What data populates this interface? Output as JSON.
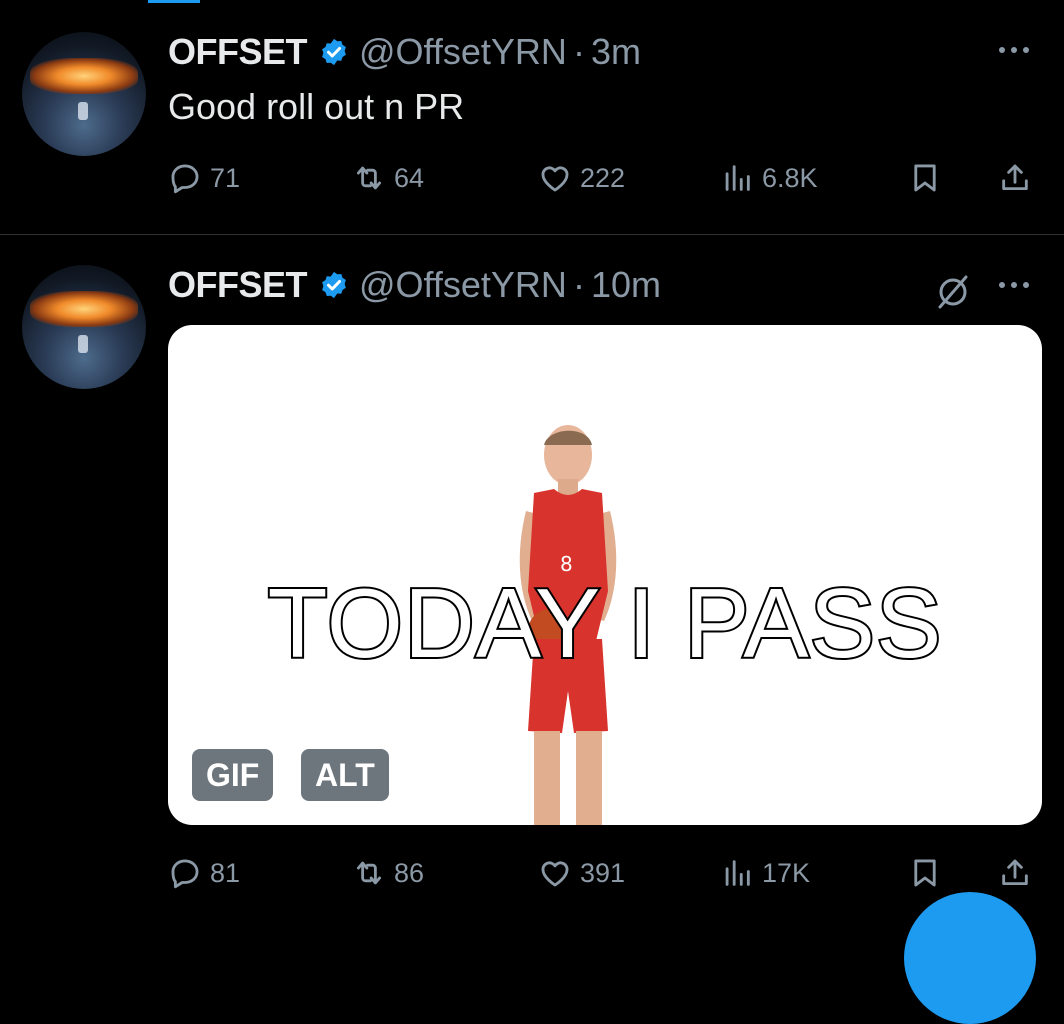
{
  "tweets": [
    {
      "name": "OFFSET",
      "handle": "@OffsetYRN",
      "separator": "·",
      "time": "3m",
      "text": "Good roll out n PR",
      "stats": {
        "replies": "71",
        "retweets": "64",
        "likes": "222",
        "views": "6.8K"
      }
    },
    {
      "name": "OFFSET",
      "handle": "@OffsetYRN",
      "separator": "·",
      "time": "10m",
      "media": {
        "caption": "TODAY I PASS",
        "gif_badge": "GIF",
        "alt_badge": "ALT",
        "jersey_number": "8"
      },
      "stats": {
        "replies": "81",
        "retweets": "86",
        "likes": "391",
        "views": "17K"
      }
    }
  ],
  "colors": {
    "background": "#000000",
    "accent": "#1d9bf0",
    "text_primary": "#e7e9ea",
    "text_secondary": "#8b98a5",
    "jersey": "#d8332c"
  },
  "icons": [
    "verified-badge-icon",
    "more-icon",
    "reply-icon",
    "retweet-icon",
    "like-icon",
    "views-icon",
    "bookmark-icon",
    "share-icon",
    "grok-slash-icon"
  ]
}
